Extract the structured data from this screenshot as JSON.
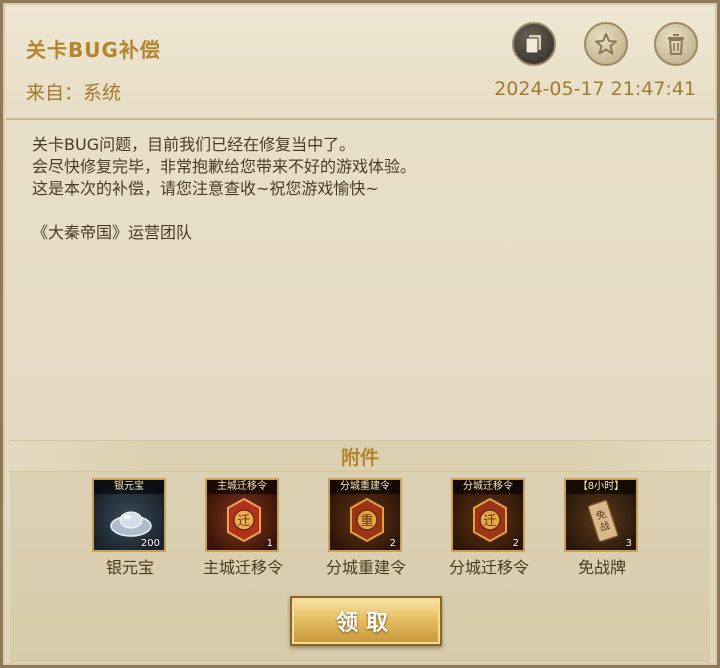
{
  "mail": {
    "title": "关卡BUG补偿",
    "from": "来自：系统",
    "date": "2024-05-17 21:47:41",
    "body_lines": [
      "关卡BUG问题，目前我们已经在修复当中了。",
      "会尽快修复完毕，非常抱歉给您带来不好的游戏体验。",
      "这是本次的补偿，请您注意查收~祝您游戏愉快~"
    ],
    "signature": "《大秦帝国》运营团队"
  },
  "actions": {
    "copy_icon": "copy-icon",
    "star_icon": "star-icon",
    "trash_icon": "trash-icon"
  },
  "attachments": {
    "title": "附件",
    "items": [
      {
        "tag": "银元宝",
        "count": "200",
        "name": "银元宝",
        "icon": "silver-ingot-icon"
      },
      {
        "tag": "主城迁移令",
        "count": "1",
        "name": "主城迁移令",
        "icon": "token-icon"
      },
      {
        "tag": "分城重建令",
        "count": "2",
        "name": "分城重建令",
        "icon": "token-icon"
      },
      {
        "tag": "分城迁移令",
        "count": "2",
        "name": "分城迁移令",
        "icon": "token-icon"
      },
      {
        "tag": "【8小时】",
        "count": "3",
        "name": "免战牌",
        "icon": "scroll-icon"
      }
    ]
  },
  "claim_label": "领取",
  "colors": {
    "accent_gold": "#b4842f",
    "text_brown": "#4b3b25",
    "panel_bg": "#e6dcc5"
  }
}
